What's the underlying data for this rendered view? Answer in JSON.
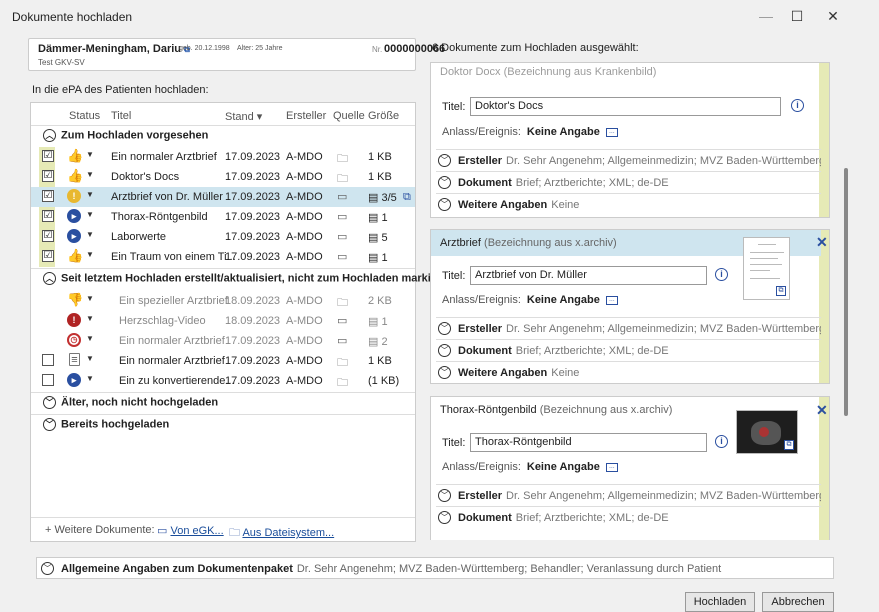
{
  "window": {
    "title": "Dokumente hochladen",
    "min": "—",
    "max": "☐",
    "close": "✕"
  },
  "patient": {
    "name": "Dämmer-Meningham, Dariu",
    "dob": "geb. 20.12.1998",
    "age": "Alter: 25 Jahre",
    "kasse": "Test GKV-SV",
    "nr_label": "Nr.",
    "nr": "0000000066"
  },
  "left": {
    "heading": "In die ePA des Patienten hochladen:",
    "columns": {
      "status": "Status",
      "title": "Titel",
      "stand": "Stand ▾",
      "ersteller": "Ersteller",
      "quelle": "Quelle",
      "groesse": "Größe"
    },
    "groups": {
      "g1": "Zum Hochladen vorgesehen",
      "g2": "Seit letztem Hochladen erstellt/aktualisiert, nicht zum Hochladen markiert",
      "g3": "Älter, noch nicht hochgeladen",
      "g4": "Bereits hochgeladen"
    },
    "rows": [
      {
        "title": "Ein normaler Arztbrief",
        "date": "17.09.2023",
        "author": "A-MDO",
        "size": "1 KB",
        "check": "☑"
      },
      {
        "title": "Doktor's Docs",
        "date": "17.09.2023",
        "author": "A-MDO",
        "size": "1 KB",
        "check": "☑"
      },
      {
        "title": "Arztbrief von Dr. Müller",
        "date": "17.09.2023",
        "author": "A-MDO",
        "size": "3/5",
        "check": "☑"
      },
      {
        "title": "Thorax-Röntgenbild",
        "date": "17.09.2023",
        "author": "A-MDO",
        "size": "1",
        "check": "☑"
      },
      {
        "title": "Laborwerte",
        "date": "17.09.2023",
        "author": "A-MDO",
        "size": "5",
        "check": "☑"
      },
      {
        "title": "Ein Traum von einem Ti...",
        "date": "17.09.2023",
        "author": "A-MDO",
        "size": "1",
        "check": "☑"
      },
      {
        "title": "Ein spezieller Arztbrief",
        "date": "18.09.2023",
        "author": "A-MDO",
        "size": "2 KB"
      },
      {
        "title": "Herzschlag-Video",
        "date": "18.09.2023",
        "author": "A-MDO",
        "size": "1"
      },
      {
        "title": "Ein normaler Arztbrief",
        "date": "17.09.2023",
        "author": "A-MDO",
        "size": "2"
      },
      {
        "title": "Ein normaler Arztbrief",
        "date": "17.09.2023",
        "author": "A-MDO",
        "size": "1 KB"
      },
      {
        "title": "Ein zu konvertierende...",
        "date": "17.09.2023",
        "author": "A-MDO",
        "size": "(1 KB)"
      }
    ],
    "footer": {
      "add": "Weitere Dokumente:",
      "egk": "Von eGK...",
      "file": "Aus Dateisystem..."
    }
  },
  "right": {
    "heading": "6 Dokumente zum Hochladen ausgewählt:",
    "cut_header": "Doktor Docx (Bezeichnung aus Krankenbild)",
    "title_label": "Titel:",
    "anlass_label": "Anlass/Ereignis:",
    "anlass_value": "Keine Angabe",
    "ersteller_label": "Ersteller",
    "ersteller_value": "Dr. Sehr Angenehm; Allgemeinmedizin; MVZ Baden-Württemberg; Arzt...",
    "dokument_label": "Dokument",
    "dokument_value": "Brief; Arztberichte; XML; de-DE",
    "weitere_label": "Weitere Angaben",
    "weitere_value": "Keine",
    "cards": [
      {
        "title_value": "Doktor's Docs"
      },
      {
        "name": "Arztbrief",
        "sub": "(Bezeichnung aus x.archiv)",
        "title_value": "Arztbrief von Dr. Müller"
      },
      {
        "name": "Thorax-Röntgenbild",
        "sub": "(Bezeichnung aus x.archiv)",
        "title_value": "Thorax-Röntgenbild"
      }
    ]
  },
  "paket": {
    "label": "Allgemeine Angaben zum Dokumentenpaket",
    "value": "Dr. Sehr Angenehm; MVZ Baden-Württemberg; Behandler; Veranlassung durch Patient"
  },
  "buttons": {
    "upload": "Hochladen",
    "cancel": "Abbrechen"
  },
  "colors": {
    "accent_blue": "#2a4fa0",
    "selected_row": "#cfe5ef",
    "group_mark": "#e6eab6"
  }
}
